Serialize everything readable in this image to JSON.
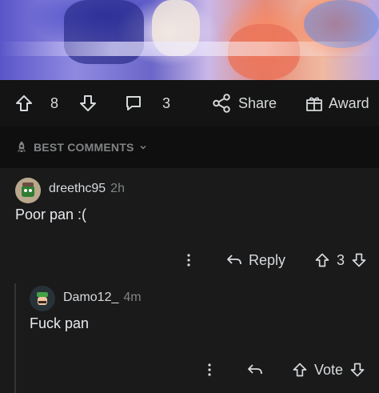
{
  "post_actions": {
    "upvote_count": "8",
    "comment_count": "3",
    "share_label": "Share",
    "award_label": "Award"
  },
  "sort": {
    "label": "BEST COMMENTS"
  },
  "comments": [
    {
      "author": "dreethc95",
      "age": "2h",
      "body": "Poor pan :(",
      "reply_label": "Reply",
      "score": "3"
    },
    {
      "author": "Damo12_",
      "age": "4m",
      "body": "Fuck pan",
      "vote_label": "Vote"
    }
  ],
  "colors": {
    "background": "#0f0f0f",
    "comment_bg": "#1a1a1b",
    "text": "#d7dadc",
    "muted": "#818384"
  }
}
